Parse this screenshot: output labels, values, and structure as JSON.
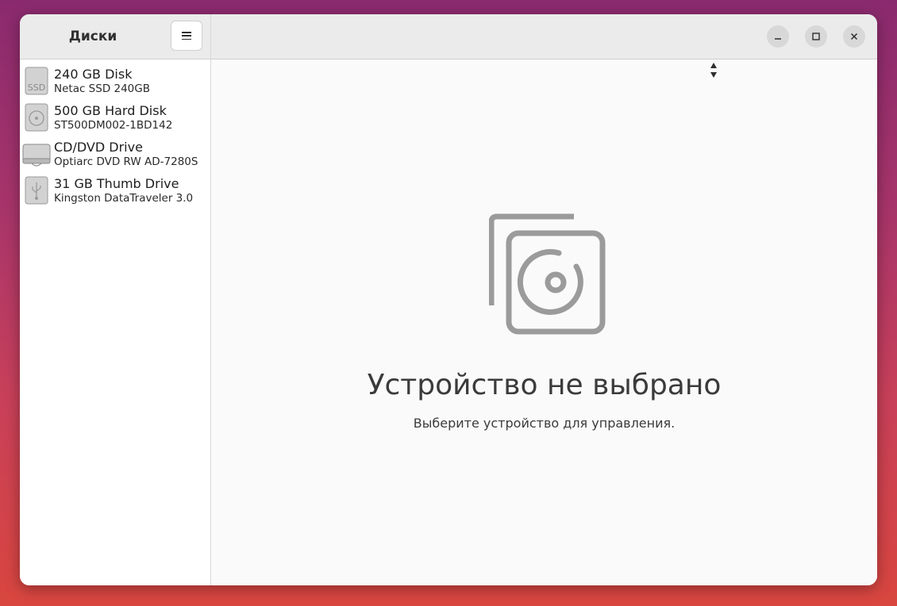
{
  "sidebar": {
    "title": "Диски",
    "menu_icon": "hamburger-menu-icon",
    "devices": [
      {
        "name": "240 GB Disk",
        "model": "Netac SSD 240GB",
        "icon": "ssd-icon",
        "icon_label": "SSD"
      },
      {
        "name": "500 GB Hard Disk",
        "model": "ST500DM002-1BD142",
        "icon": "hard-disk-icon"
      },
      {
        "name": "CD/DVD Drive",
        "model": "Optiarc DVD RW AD-7280S",
        "icon": "optical-drive-icon"
      },
      {
        "name": "31 GB Thumb Drive",
        "model": "Kingston DataTraveler 3.0",
        "icon": "usb-drive-icon"
      }
    ]
  },
  "window_controls": {
    "minimize_icon": "minimize-icon",
    "maximize_icon": "maximize-icon",
    "close_icon": "close-icon"
  },
  "main": {
    "empty_state": {
      "title": "Устройство не выбрано",
      "subtitle": "Выберите устройство для управления.",
      "icon": "disks-app-icon"
    }
  }
}
